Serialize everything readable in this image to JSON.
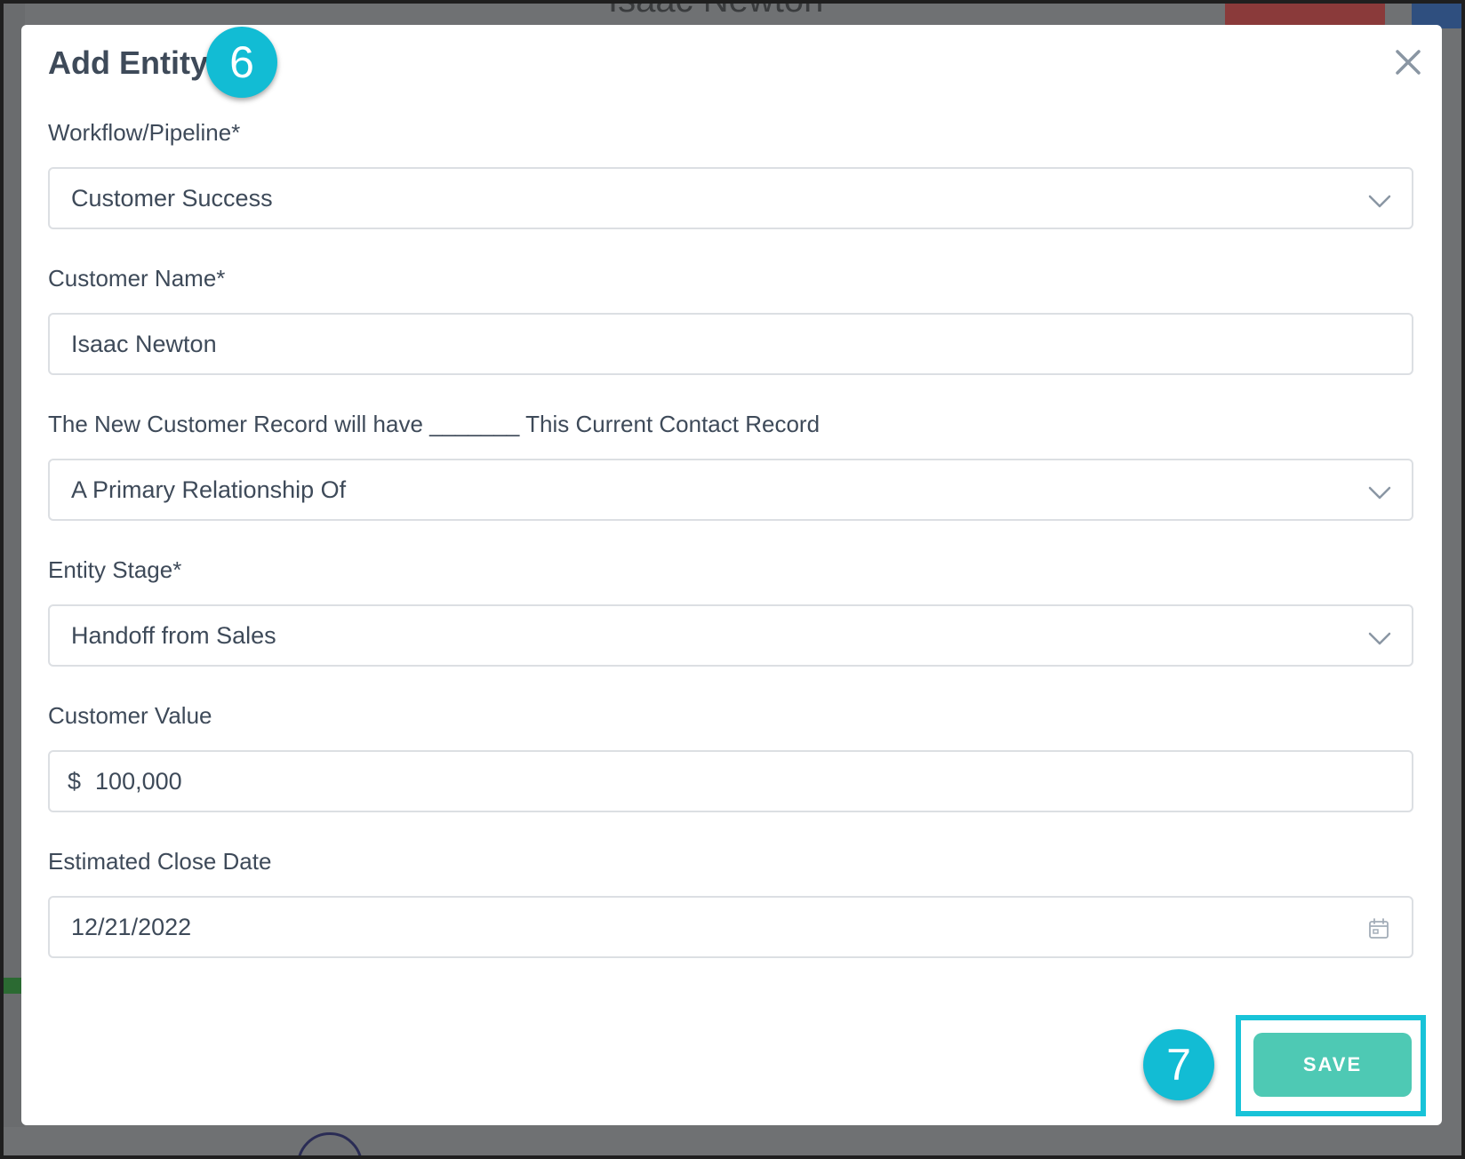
{
  "background": {
    "page_title": "Isaac Newton"
  },
  "modal": {
    "title": "Add Entity",
    "step_badges": {
      "title_step": "6",
      "save_step": "7"
    },
    "close_icon": "close-icon",
    "fields": {
      "workflow": {
        "label": "Workflow/Pipeline*",
        "value": "Customer Success",
        "icon": "chevron-down-icon"
      },
      "customer_name": {
        "label": "Customer Name*",
        "value": "Isaac Newton"
      },
      "relationship": {
        "label": "The New Customer Record will have _______ This Current Contact Record",
        "value": "A Primary Relationship Of",
        "icon": "chevron-down-icon"
      },
      "entity_stage": {
        "label": "Entity Stage*",
        "value": "Handoff from Sales",
        "icon": "chevron-down-icon"
      },
      "customer_value": {
        "label": "Customer Value",
        "prefix": "$",
        "value": "100,000"
      },
      "close_date": {
        "label": "Estimated Close Date",
        "value": "12/21/2022",
        "icon": "calendar-icon"
      }
    },
    "save_label": "SAVE"
  },
  "colors": {
    "badge": "#12bcd4",
    "save_button": "#4ec9b4",
    "highlight": "#18c3d8",
    "text": "#3e4a59"
  }
}
